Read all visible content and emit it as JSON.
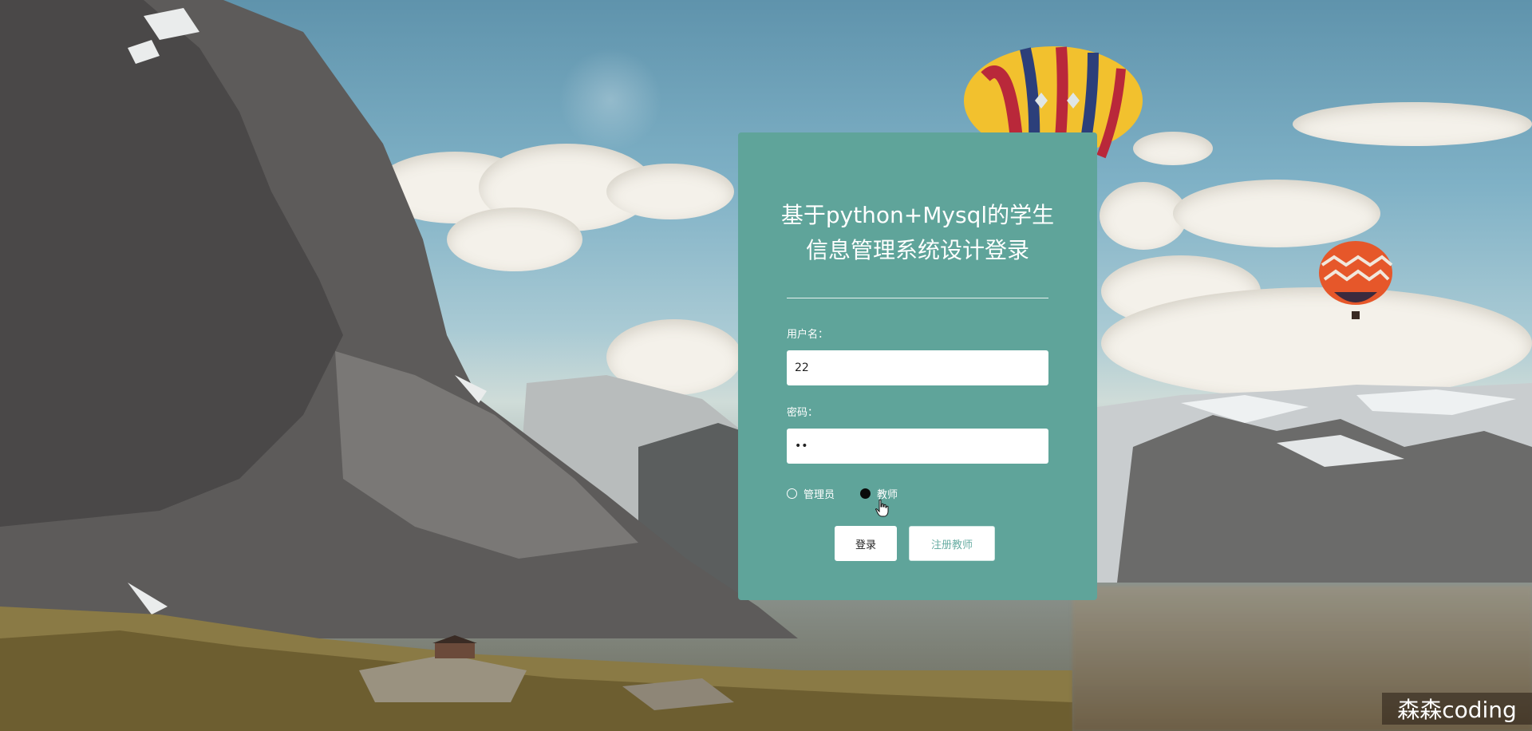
{
  "page": {
    "background": "mountain-landscape-with-hot-air-balloons"
  },
  "login": {
    "title": "基于python+Mysql的学生信息管理系统设计登录",
    "username_label": "用户名：",
    "username_value": "22",
    "password_label": "密码：",
    "password_value": "••",
    "roles": [
      {
        "label": "管理员",
        "checked": false
      },
      {
        "label": "教师",
        "checked": true
      }
    ],
    "login_button": "登录",
    "register_button": "注册教师"
  },
  "watermark": {
    "text": "森森coding"
  },
  "colors": {
    "card_bg": "#5fa49a",
    "register_text": "#6aaea4"
  },
  "icons": {
    "cursor": "hand-pointer-icon"
  }
}
